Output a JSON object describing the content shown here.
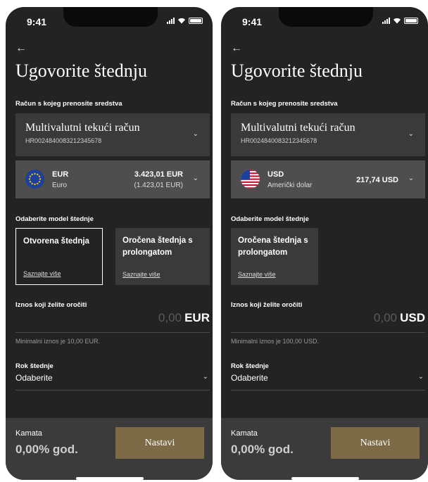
{
  "screens": [
    {
      "status": {
        "time": "9:41"
      },
      "back_icon": "←",
      "title": "Ugovorite štednju",
      "account_section_label": "Račun s kojeg prenosite sredstva",
      "account": {
        "name": "Multivalutni tekući račun",
        "iban": "HR0024840083212345678"
      },
      "currency": {
        "code": "EUR",
        "name": "Euro",
        "balance": "3.423,01 EUR",
        "balance_secondary": "(1.423,01 EUR)",
        "flag": "eu-flag-icon"
      },
      "model_section_label": "Odaberite model štednje",
      "models": [
        {
          "title": "Otvorena štednja",
          "link": "Saznajte više",
          "selected": true
        },
        {
          "title": "Oročena štednja s prolongatom",
          "link": "Saznajte više",
          "selected": false
        }
      ],
      "amount": {
        "label": "Iznos koji želite oročiti",
        "value": "0,00",
        "currency": "EUR",
        "hint": "Minimalni iznos je 10,00 EUR."
      },
      "term": {
        "label": "Rok štednje",
        "value": "Odaberite"
      },
      "footer": {
        "rate_label": "Kamata",
        "rate_value": "0,00% god.",
        "continue_label": "Nastavi"
      }
    },
    {
      "status": {
        "time": "9:41"
      },
      "back_icon": "←",
      "title": "Ugovorite štednju",
      "account_section_label": "Račun s kojeg prenosite sredstva",
      "account": {
        "name": "Multivalutni tekući račun",
        "iban": "HR0024840083212345678"
      },
      "currency": {
        "code": "USD",
        "name": "Američki dolar",
        "balance": "217,74 USD",
        "flag": "us-flag-icon"
      },
      "model_section_label": "Odaberite model štednje",
      "models": [
        {
          "title": "Oročena štednja s prolongatom",
          "link": "Saznajte više",
          "selected": false
        }
      ],
      "amount": {
        "label": "Iznos koji želite oročiti",
        "value": "0,00",
        "currency": "USD",
        "hint": "Minimalni iznos je 100,00 USD."
      },
      "term": {
        "label": "Rok štednje",
        "value": "Odaberite"
      },
      "footer": {
        "rate_label": "Kamata",
        "rate_value": "0,00% god.",
        "continue_label": "Nastavi"
      }
    }
  ],
  "colors": {
    "background": "#232323",
    "panel": "#3a3a3a",
    "accent": "#7d6b47"
  }
}
